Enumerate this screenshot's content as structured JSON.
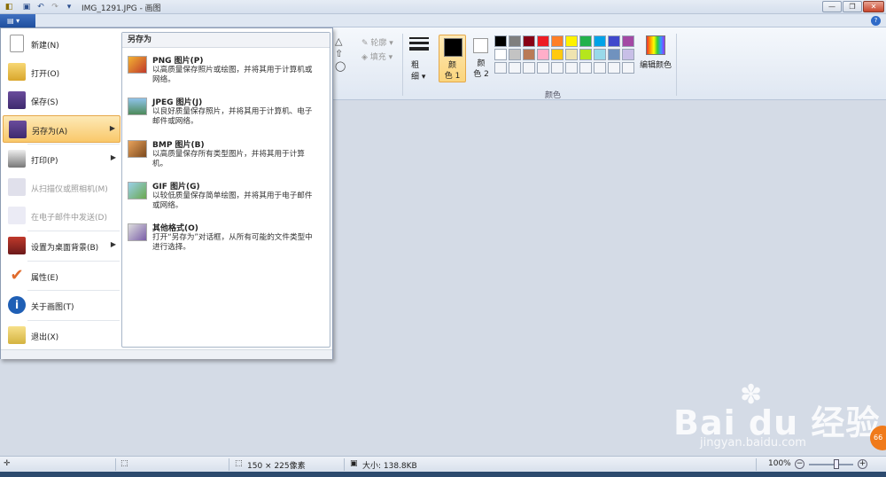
{
  "window": {
    "title": "IMG_1291.JPG - 画图",
    "qa_dropdown": "▾",
    "btn_minimize": "—",
    "btn_maximize": "❐",
    "btn_close": "✕"
  },
  "ribbon": {
    "file_button": "▤ ▾",
    "help": "?",
    "outline_label": "轮廓",
    "fill_label": "填充",
    "size_label": "粗\n细",
    "size_line1": "粗",
    "size_line2": "细 ▾",
    "color1_line1": "颜",
    "color1_line2": "色 1",
    "color2_line1": "颜",
    "color2_line2": "色 2",
    "edit_colors": "编辑颜色",
    "colors_group": "颜色",
    "palette_row1": [
      "#000000",
      "#7f7f7f",
      "#880015",
      "#ed1c24",
      "#ff7f27",
      "#fff200",
      "#22b14c",
      "#00a2e8",
      "#3f48cc",
      "#a349a4"
    ],
    "palette_row2": [
      "#ffffff",
      "#c3c3c3",
      "#b97a57",
      "#ffaec9",
      "#ffc90e",
      "#efe4b0",
      "#b5e61d",
      "#99d9ea",
      "#7092be",
      "#c8bfe7"
    ]
  },
  "menu": {
    "items": [
      {
        "label": "新建(N)"
      },
      {
        "label": "打开(O)"
      },
      {
        "label": "保存(S)"
      },
      {
        "label": "另存为(A)"
      },
      {
        "label": "打印(P)"
      },
      {
        "label": "从扫描仪或照相机(M)"
      },
      {
        "label": "在电子邮件中发送(D)"
      },
      {
        "label": "设置为桌面背景(B)"
      },
      {
        "label": "属性(E)"
      },
      {
        "label": "关于画图(T)"
      },
      {
        "label": "退出(X)"
      }
    ],
    "submenu_title": "另存为",
    "subitems": [
      {
        "title": "PNG 图片(P)",
        "desc": "以高质量保存照片或绘图，并将其用于计算机或网络。"
      },
      {
        "title": "JPEG 图片(J)",
        "desc": "以良好质量保存照片，并将其用于计算机、电子邮件或网络。"
      },
      {
        "title": "BMP 图片(B)",
        "desc": "以高质量保存所有类型图片，并将其用于计算机。"
      },
      {
        "title": "GIF 图片(G)",
        "desc": "以较低质量保存简单绘图，并将其用于电子邮件或网络。"
      },
      {
        "title": "其他格式(O)",
        "desc": "打开“另存为”对话框，从所有可能的文件类型中进行选择。"
      }
    ]
  },
  "status": {
    "dimensions": "150 × 225像素",
    "filesize": "大小: 138.8KB",
    "zoom": "100%"
  },
  "watermark": {
    "main": "Bai du 经验",
    "sub": "jingyan.baidu.com",
    "badge": "66"
  }
}
